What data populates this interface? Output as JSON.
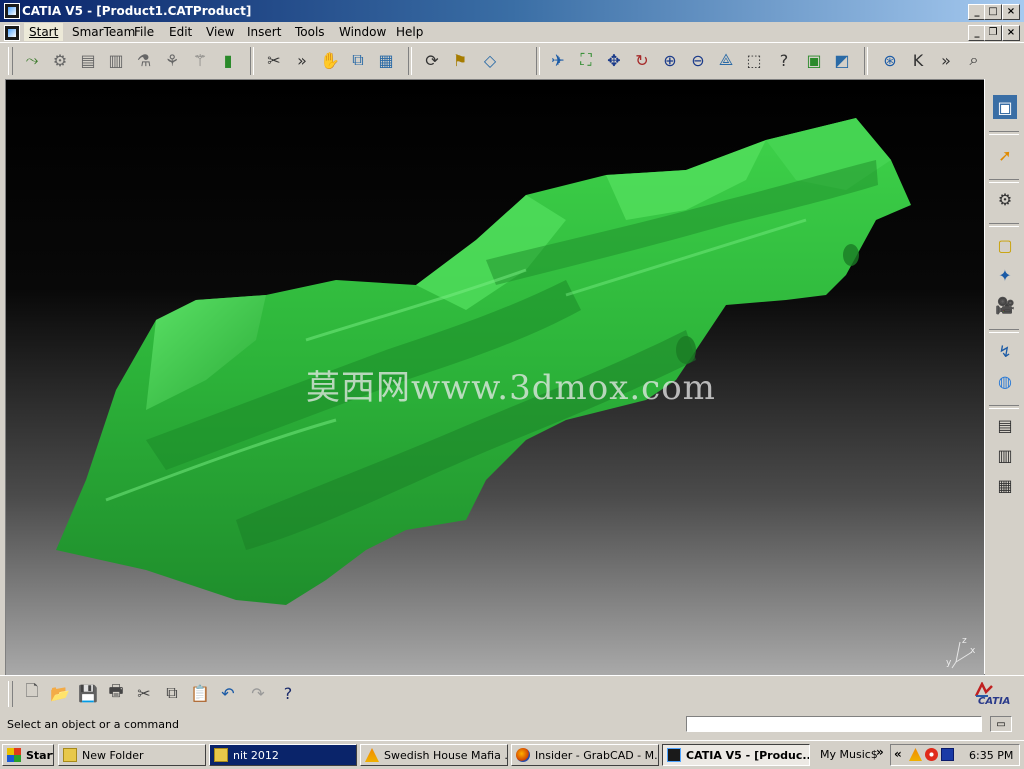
{
  "window": {
    "title": "CATIA V5 - [Product1.CATProduct]",
    "controls": {
      "minimize": "_",
      "maximize": "□",
      "close": "×"
    }
  },
  "menu": {
    "items": [
      "Start",
      "SmarTeam",
      "File",
      "Edit",
      "View",
      "Insert",
      "Tools",
      "Window",
      "Help"
    ],
    "doc_controls": {
      "minimize": "_",
      "restore": "❐",
      "close": "×"
    }
  },
  "viewport": {
    "watermark": "莫西网www.3dmox.com",
    "compass_axes": {
      "z": "z",
      "x": "x",
      "y": "y"
    },
    "model_color": "#2fb83a"
  },
  "status": {
    "message": "Select an object or a command",
    "command_value": ""
  },
  "branding": {
    "logo": "CATIA"
  },
  "taskbar": {
    "start": "Start",
    "items": [
      {
        "label": "New Folder",
        "icon": "folder-icon"
      },
      {
        "label": "nit 2012",
        "icon": "folder-icon"
      },
      {
        "label": "Swedish House Mafia ...",
        "icon": "vlc-icon"
      },
      {
        "label": "Insider - GrabCAD - M...",
        "icon": "firefox-icon"
      },
      {
        "label": "CATIA V5 - [Produc...",
        "icon": "catia-icon"
      }
    ],
    "quick": "My Music$",
    "clock": "6:35 PM"
  },
  "colors": {
    "accent": "#0a246a",
    "chrome": "#d4d0c8",
    "model": "#2fb83a"
  }
}
